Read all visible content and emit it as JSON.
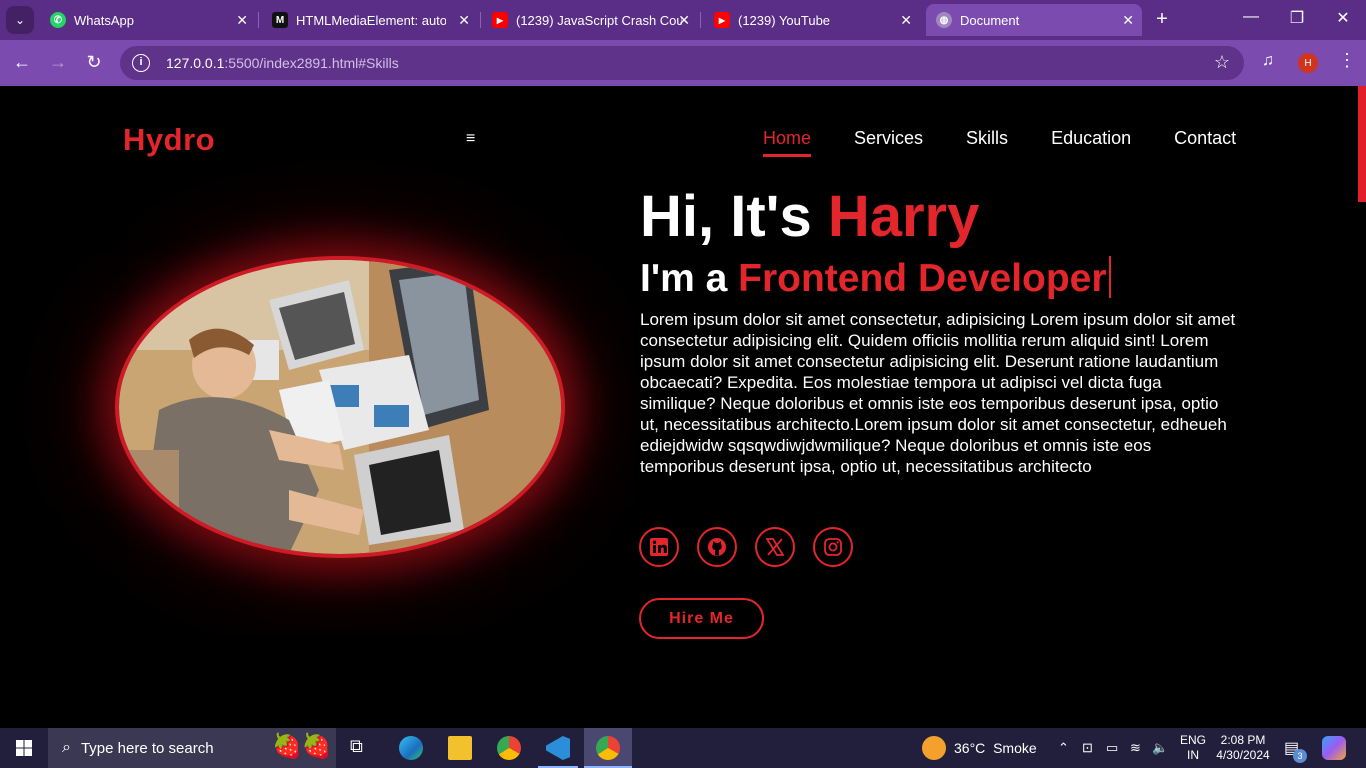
{
  "browser": {
    "tabs": [
      {
        "title": "WhatsApp",
        "icon": "whatsapp-icon"
      },
      {
        "title": "HTMLMediaElement: autopla",
        "icon": "mdn-icon"
      },
      {
        "title": "(1239) JavaScript Crash Cour",
        "icon": "youtube-icon"
      },
      {
        "title": "(1239) YouTube",
        "icon": "youtube-icon"
      },
      {
        "title": "Document",
        "icon": "globe-icon",
        "active": true
      }
    ],
    "url_host": "127.0.0.1",
    "url_rest": ":5500/index2891.html#Skills",
    "profile_initial": "H"
  },
  "site": {
    "logo": "Hydro",
    "nav": [
      "Home",
      "Services",
      "Skills",
      "Education",
      "Contact"
    ],
    "active_nav": "Home",
    "hero_hi": "Hi, It's ",
    "hero_name": "Harry",
    "hero_im": "I'm a ",
    "hero_role": "Frontend Developer",
    "hero_paragraph": "Lorem ipsum dolor sit amet consectetur, adipisicing Lorem ipsum dolor sit amet consectetur adipisicing elit. Quidem officiis mollitia rerum aliquid sint! Lorem ipsum dolor sit amet consectetur adipisicing elit. Deserunt ratione laudantium obcaecati? Expedita. Eos molestiae tempora ut adipisci vel dicta fuga similique? Neque doloribus et omnis iste eos temporibus deserunt ipsa, optio ut, necessitatibus architecto.Lorem ipsum dolor sit amet consectetur, edheueh ediejdwidw sqsqwdiwjdwmilique? Neque doloribus et omnis iste eos temporibus deserunt ipsa, optio ut, necessitatibus architecto",
    "socials": [
      "linkedin-icon",
      "github-icon",
      "x-icon",
      "instagram-icon"
    ],
    "hire_label": "Hire Me",
    "accent": "#e3262b"
  },
  "taskbar": {
    "search_placeholder": "Type here to search",
    "weather_temp": "36°C",
    "weather_text": "Smoke",
    "lang_top": "ENG",
    "lang_bottom": "IN",
    "time": "2:08 PM",
    "date": "4/30/2024",
    "notification_count": "3"
  }
}
